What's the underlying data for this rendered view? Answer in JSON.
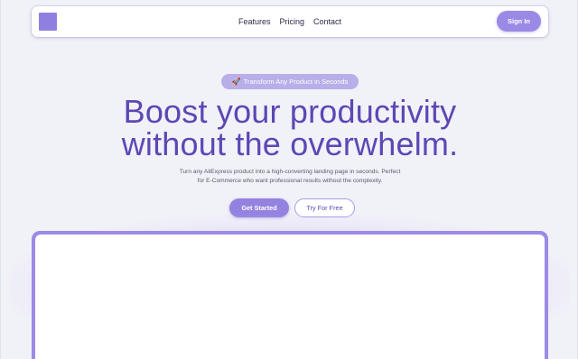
{
  "nav": {
    "links": [
      {
        "label": "Features"
      },
      {
        "label": "Pricing"
      },
      {
        "label": "Contact"
      }
    ],
    "signin_label": "Sign In"
  },
  "hero": {
    "badge_icon": "rocket-icon",
    "badge_glyph": "🚀",
    "badge_text": "Transform Any Product in Seconds",
    "headline_line1": "Boost your productivity",
    "headline_line2": "without the overwhelm.",
    "subtext_line1": "Turn any AliExpress product into a high-converting landing page in seconds. Perfect",
    "subtext_line2": "for E-Commerce who want professional results without the complexity.",
    "primary_cta": "Get Started",
    "secondary_cta": "Try For Free"
  },
  "colors": {
    "accent": "#9482e0",
    "headline": "#5d47b4",
    "background": "#f1f1f8"
  }
}
